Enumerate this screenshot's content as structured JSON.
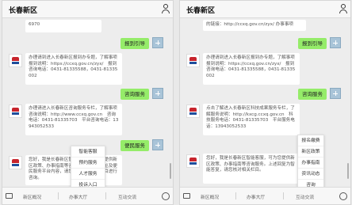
{
  "left": {
    "title": "长春新区",
    "top_snippet": "6970",
    "messages": {
      "m1_out": "报到引导",
      "m1_in": "办理请到进入长春新区报到办专题，了解事项报到说明：https://ccxq.gov.cn/zyx/　报到咨询电话：0431-81335588，0431-81335002",
      "m2_out": "咨询服务",
      "m2_in": "办理请进入长春新区咨询服务专栏，了解事项咨询说明：http://www.ccxq.gov.cn　咨询电话：0431-81335703　平台咨询电话：13943052533",
      "m3_out": "便民服务",
      "m3_in": "您好，我是长春新区智能客服，可为您提供新区政策、办事指南等咨询服务。广告地址及便民服务平台内容，请您到本平台相关栏目进行咨询。"
    },
    "menu": [
      "智能客服",
      "预约服务",
      "人才服务",
      "投诉入口"
    ],
    "tabs": [
      "新区概况",
      "办事大厅",
      "互动交流"
    ]
  },
  "right": {
    "title": "长春新区",
    "top_snippet": "的链接：http://ccxq.gov.cn/zyx/ 办事事项",
    "messages": {
      "m1_out": "报到引导",
      "m1_in": "办理请到进入长春新区报到办专题，了解事项报到说明：https://ccxq.gov.cn/zyx/　报到咨询电话：0431-81335588，0431-81335002",
      "m2_out": "咨询服务",
      "m2_in": "点击了解进入长春新区科技成果服务专栏，了解服务说明：http://kxcg.ccxq.gov.cn　科技服务电话：0431-81335703　平台服务电话：13943052533",
      "m3_in": "您好，我是长春新区智能客服，可为您提供新区政策、办事指南等咨询服务。上述回复为智能答复，请您核对相关栏目。"
    },
    "menu": [
      "报名缴费",
      "新区政策",
      "办事指南",
      "资讯动态",
      "咨询"
    ],
    "tabs": [
      "新区概况",
      "办事大厅",
      "互动交流"
    ]
  }
}
